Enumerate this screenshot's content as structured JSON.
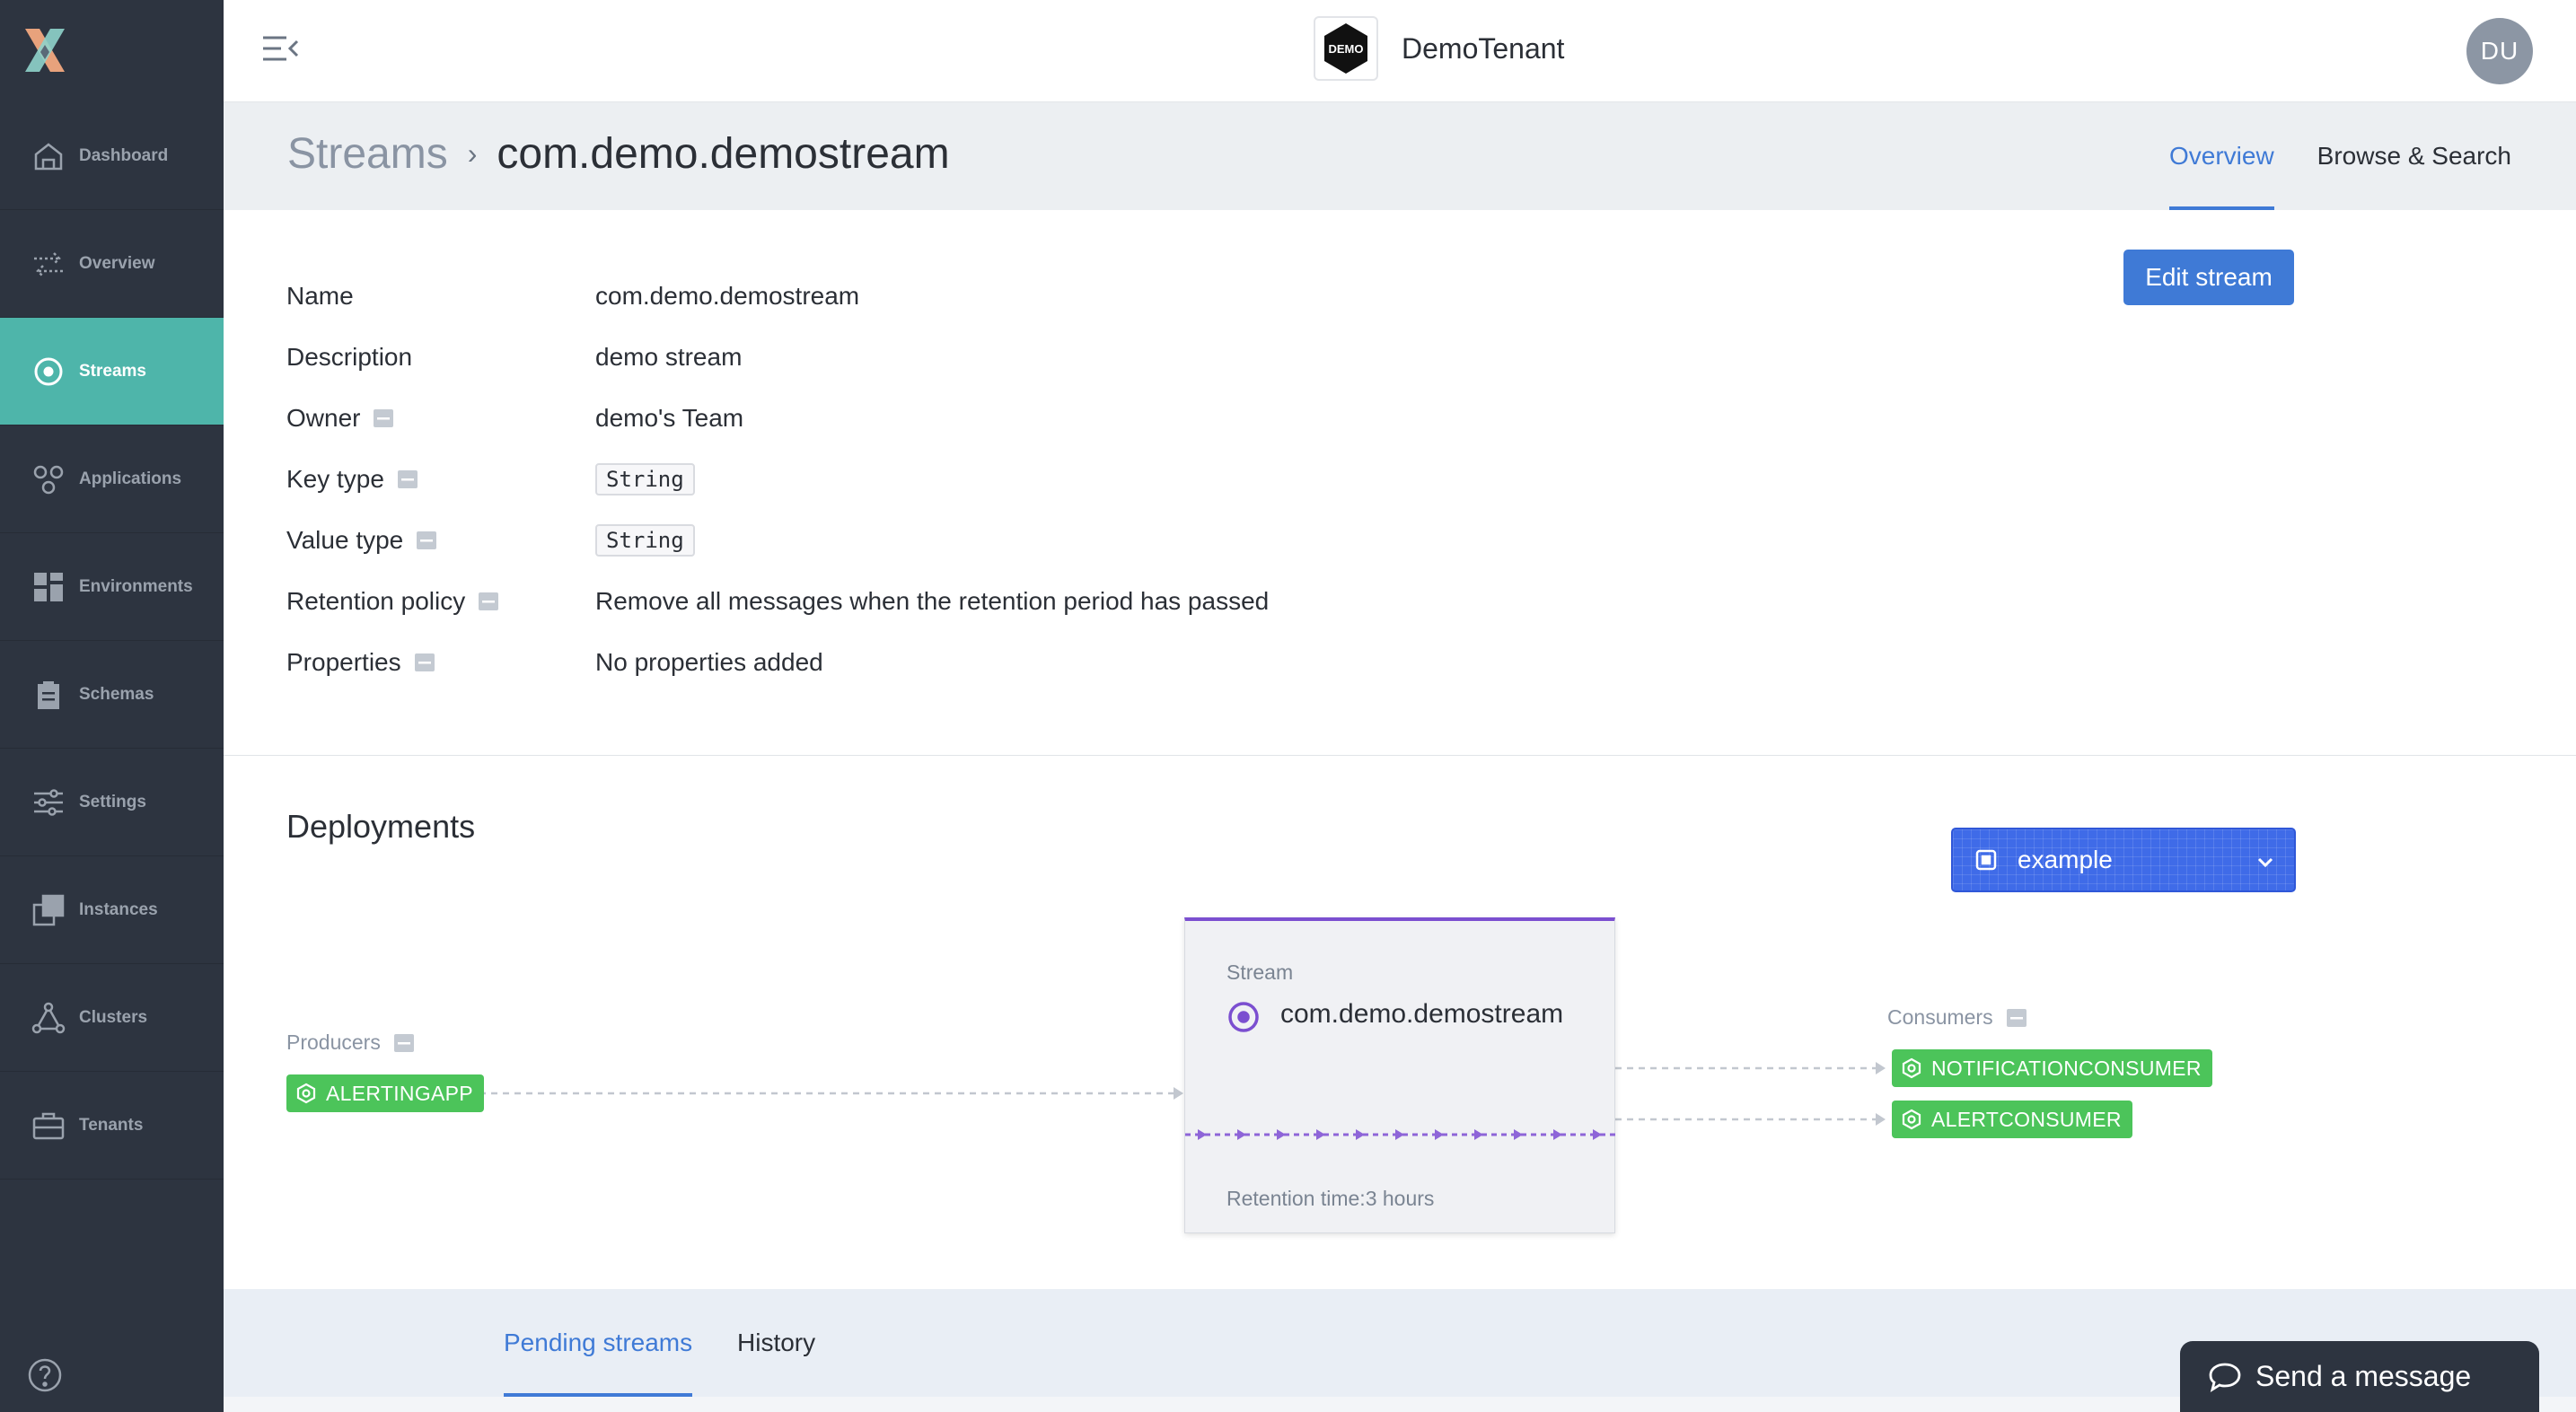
{
  "sidebar": {
    "items": [
      {
        "label": "Dashboard",
        "icon": "home-icon"
      },
      {
        "label": "Overview",
        "icon": "arrows-icon"
      },
      {
        "label": "Streams",
        "icon": "stream-icon"
      },
      {
        "label": "Applications",
        "icon": "applications-icon"
      },
      {
        "label": "Environments",
        "icon": "grid-icon"
      },
      {
        "label": "Schemas",
        "icon": "clipboard-icon"
      },
      {
        "label": "Settings",
        "icon": "sliders-icon"
      },
      {
        "label": "Instances",
        "icon": "instances-icon"
      },
      {
        "label": "Clusters",
        "icon": "cluster-icon"
      },
      {
        "label": "Tenants",
        "icon": "briefcase-icon"
      }
    ],
    "active_index": 2
  },
  "header": {
    "tenant_logo_text": "DEMO",
    "tenant_name": "DemoTenant",
    "avatar_initials": "DU"
  },
  "subheader": {
    "breadcrumb_root": "Streams",
    "breadcrumb_current": "com.demo.demostream",
    "tabs": [
      {
        "label": "Overview",
        "active": true
      },
      {
        "label": "Browse & Search",
        "active": false
      }
    ]
  },
  "details": {
    "edit_button": "Edit stream",
    "rows": [
      {
        "label": "Name",
        "value": "com.demo.demostream"
      },
      {
        "label": "Description",
        "value": "demo stream"
      },
      {
        "label": "Owner",
        "value": "demo's Team"
      },
      {
        "label": "Key type",
        "value": "String"
      },
      {
        "label": "Value type",
        "value": "String"
      },
      {
        "label": "Retention policy",
        "value": "Remove all messages when the retention period has passed"
      },
      {
        "label": "Properties",
        "value": "No properties added"
      }
    ]
  },
  "deployments": {
    "title": "Deployments",
    "environment": "example",
    "producers_label": "Producers",
    "consumers_label": "Consumers",
    "producers": [
      "ALERTINGAPP"
    ],
    "consumers": [
      "NOTIFICATIONCONSUMER",
      "ALERTCONSUMER"
    ],
    "card": {
      "type_label": "Stream",
      "name": "com.demo.demostream",
      "retention": "Retention time:3 hours"
    }
  },
  "bottom_tabs": [
    {
      "label": "Pending streams",
      "active": true
    },
    {
      "label": "History",
      "active": false
    }
  ],
  "chat": {
    "label": "Send a message"
  },
  "colors": {
    "sidebar_bg": "#2d3440",
    "sidebar_active": "#4eb5aa",
    "primary": "#3f7ad6",
    "app_badge": "#4cc45a",
    "stream_accent": "#7b4fd0",
    "code_text": "#d0342c"
  }
}
